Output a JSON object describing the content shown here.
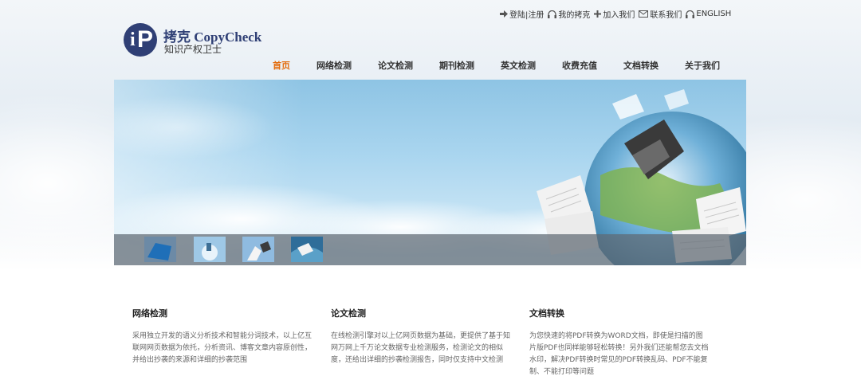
{
  "header": {
    "brand_title": "拷克 CopyCheck",
    "brand_subtitle": "知识产权卫士",
    "top_links": [
      {
        "label": "登陆|注册",
        "icon": "arrow-login-icon"
      },
      {
        "label": "我的拷克",
        "icon": "headset-icon"
      },
      {
        "label": "加入我们",
        "icon": "plus-icon"
      },
      {
        "label": "联系我们",
        "icon": "envelope-icon"
      },
      {
        "label": "ENGLISH",
        "icon": "headset-icon"
      }
    ]
  },
  "nav": {
    "items": [
      "首页",
      "网络检测",
      "论文检测",
      "期刊检测",
      "英文检测",
      "收费充值",
      "文档转换",
      "关于我们"
    ],
    "active_index": 0
  },
  "features": [
    {
      "title": "网络检测",
      "text": "采用独立开发的语义分析技术和智能分词技术，以上亿互联网网页数据为依托，分析资讯、博客文章内容原创性，并给出抄袭的来源和详细的抄袭范围"
    },
    {
      "title": "论文检测",
      "text": "在线检测引擎对以上亿网页数据为基础，更提供了基于知网万网上千万论文数据专业检测服务，检测论文的相似度，还给出详细的抄袭检测报告，同时仅支持中文检测"
    },
    {
      "title": "文档转换",
      "text": "为您快速的将PDF转换为WORD文档，即使是扫描的图片版PDF也同样能够轻松转换！另外我们还能帮您去文档水印，解决PDF转换时常见的PDF转换乱码、PDF不能复制、不能打印等问题"
    }
  ],
  "colors": {
    "brand": "#2f3f75",
    "nav_active": "#e36b0b",
    "text": "#333333"
  }
}
